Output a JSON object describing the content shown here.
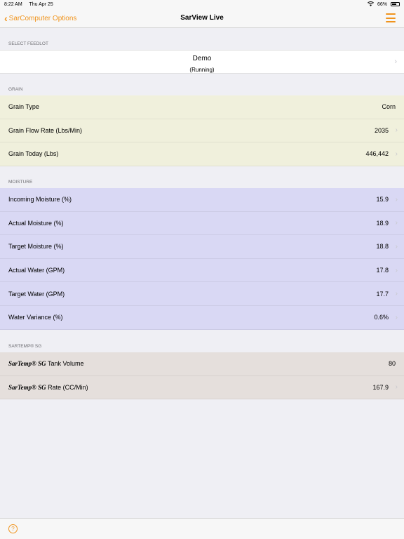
{
  "status_bar": {
    "time": "8:22 AM",
    "date": "Thu Apr 25",
    "battery_text": "66%",
    "battery_level": 0.66
  },
  "nav": {
    "back_label": "SarComputer Options",
    "title": "SarView Live"
  },
  "feedlot": {
    "header": "SELECT FEEDLOT",
    "name": "Demo",
    "status": "(Running)"
  },
  "grain": {
    "header": "GRAIN",
    "rows": [
      {
        "label": "Grain Type",
        "value": "Corn"
      },
      {
        "label": "Grain Flow Rate (Lbs/Min)",
        "value": "2035"
      },
      {
        "label": "Grain Today (Lbs)",
        "value": "446,442"
      }
    ]
  },
  "moisture": {
    "header": "MOISTURE",
    "rows": [
      {
        "label": "Incoming Moisture (%)",
        "value": "15.9"
      },
      {
        "label": "Actual Moisture (%)",
        "value": "18.9"
      },
      {
        "label": "Target Moisture (%)",
        "value": "18.8"
      },
      {
        "label": "Actual Water (GPM)",
        "value": "17.8"
      },
      {
        "label": "Target Water (GPM)",
        "value": "17.7"
      },
      {
        "label": "Water Variance (%)",
        "value": "0.6%"
      }
    ]
  },
  "sartemp": {
    "header": "SARTEMP® SG",
    "rows": [
      {
        "brand": "SarTemp® SG",
        "label": " Tank Volume",
        "value": "80"
      },
      {
        "brand": "SarTemp® SG",
        "label": " Rate (CC/Min)",
        "value": "167.9"
      }
    ]
  },
  "icons": {
    "back": "chevron-left-icon",
    "menu": "hamburger-menu-icon",
    "help": "question-circle-icon",
    "wifi": "wifi-icon",
    "battery": "battery-icon"
  },
  "colors": {
    "accent": "#f0941d",
    "grain_bg": "#f0f0dc",
    "moisture_bg": "#d9d8f4",
    "sartemp_bg": "#e5dfdc"
  }
}
